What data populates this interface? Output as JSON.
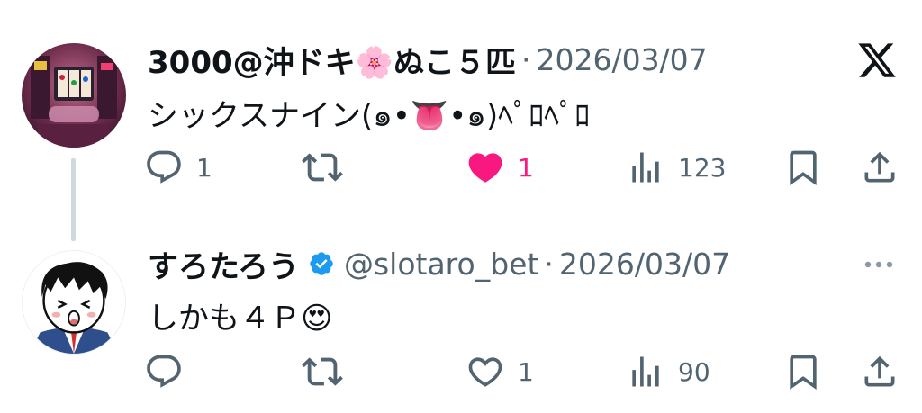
{
  "colors": {
    "text_primary": "#0f1419",
    "text_secondary": "#536471",
    "like_active": "#f91880",
    "verified": "#1d9bf0",
    "thread_line": "#cfd9de"
  },
  "header": {
    "logo_icon": "x-logo-icon"
  },
  "tweets": [
    {
      "display_name": "3000@沖ドキ🌸ぬこ５匹",
      "separator": "·",
      "timestamp": "2026/03/07",
      "text": "シックスナイン(๑•👅•๑)ﾍﾟﾛﾍﾟﾛ",
      "avatar_icon": "slot-machine-avatar",
      "actions": {
        "reply_count": "1",
        "retweet_count": "",
        "like_count": "1",
        "liked": true,
        "views_count": "123"
      }
    },
    {
      "display_name": "すろたろう",
      "verified": true,
      "handle": "@slotaro_bet",
      "separator": "·",
      "timestamp": "2026/03/07",
      "text": "しかも４Ｐ😍",
      "avatar_icon": "cartoon-businessman-avatar",
      "more_icon": "more-options-icon",
      "actions": {
        "reply_count": "",
        "retweet_count": "",
        "like_count": "1",
        "liked": false,
        "views_count": "90"
      }
    }
  ]
}
